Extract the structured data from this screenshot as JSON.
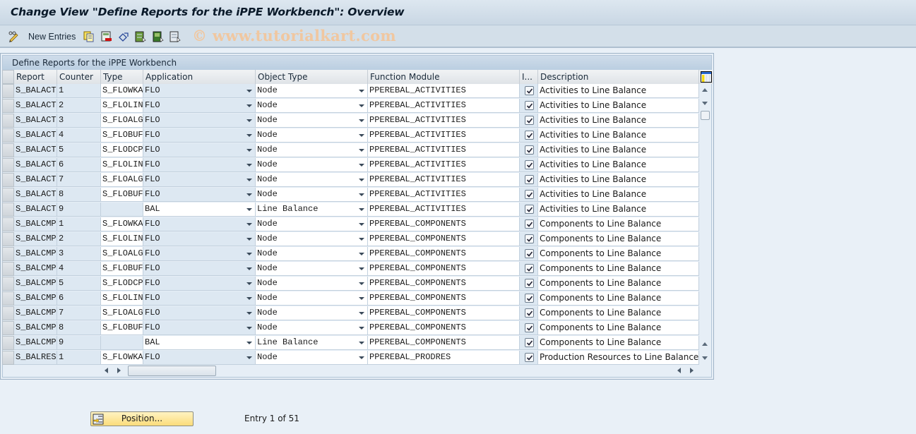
{
  "window": {
    "title": "Change View \"Define Reports for the iPPE Workbench\": Overview"
  },
  "toolbar": {
    "new_entries_label": "New Entries",
    "icons": [
      "change-display-icon",
      "copy-icon",
      "delete-icon",
      "undo-icon",
      "select-all-icon",
      "select-block-icon",
      "deselect-all-icon"
    ],
    "watermark": "www.tutorialkart.com"
  },
  "table": {
    "title": "Define Reports for the iPPE Workbench",
    "columns": [
      "Report",
      "Counter",
      "Type",
      "Application",
      "Object Type",
      "Function Module",
      "I...",
      "Description"
    ],
    "rows": [
      {
        "report": "S_BALACT",
        "counter": "1",
        "type": "S_FLOWKA",
        "application": "FLO",
        "object_type": "Node",
        "function_module": "PPEREBAL_ACTIVITIES",
        "checked": true,
        "description": "Activities to Line Balance"
      },
      {
        "report": "S_BALACT",
        "counter": "2",
        "type": "S_FLOLIN",
        "application": "FLO",
        "object_type": "Node",
        "function_module": "PPEREBAL_ACTIVITIES",
        "checked": true,
        "description": "Activities to Line Balance"
      },
      {
        "report": "S_BALACT",
        "counter": "3",
        "type": "S_FLOALG",
        "application": "FLO",
        "object_type": "Node",
        "function_module": "PPEREBAL_ACTIVITIES",
        "checked": true,
        "description": "Activities to Line Balance"
      },
      {
        "report": "S_BALACT",
        "counter": "4",
        "type": "S_FLOBUF",
        "application": "FLO",
        "object_type": "Node",
        "function_module": "PPEREBAL_ACTIVITIES",
        "checked": true,
        "description": "Activities to Line Balance"
      },
      {
        "report": "S_BALACT",
        "counter": "5",
        "type": "S_FLODCP",
        "application": "FLO",
        "object_type": "Node",
        "function_module": "PPEREBAL_ACTIVITIES",
        "checked": true,
        "description": "Activities to Line Balance"
      },
      {
        "report": "S_BALACT",
        "counter": "6",
        "type": "S_FLOLIN",
        "application": "FLO",
        "object_type": "Node",
        "function_module": "PPEREBAL_ACTIVITIES",
        "checked": true,
        "description": "Activities to Line Balance"
      },
      {
        "report": "S_BALACT",
        "counter": "7",
        "type": "S_FLOALG",
        "application": "FLO",
        "object_type": "Node",
        "function_module": "PPEREBAL_ACTIVITIES",
        "checked": true,
        "description": "Activities to Line Balance"
      },
      {
        "report": "S_BALACT",
        "counter": "8",
        "type": "S_FLOBUF",
        "application": "FLO",
        "object_type": "Node",
        "function_module": "PPEREBAL_ACTIVITIES",
        "checked": true,
        "description": "Activities to Line Balance"
      },
      {
        "report": "S_BALACT",
        "counter": "9",
        "type": "",
        "application": "BAL",
        "object_type": "Line Balance",
        "function_module": "PPEREBAL_ACTIVITIES",
        "checked": true,
        "description": "Activities to Line Balance"
      },
      {
        "report": "S_BALCMP",
        "counter": "1",
        "type": "S_FLOWKA",
        "application": "FLO",
        "object_type": "Node",
        "function_module": "PPEREBAL_COMPONENTS",
        "checked": true,
        "description": "Components to Line Balance"
      },
      {
        "report": "S_BALCMP",
        "counter": "2",
        "type": "S_FLOLIN",
        "application": "FLO",
        "object_type": "Node",
        "function_module": "PPEREBAL_COMPONENTS",
        "checked": true,
        "description": "Components to Line Balance"
      },
      {
        "report": "S_BALCMP",
        "counter": "3",
        "type": "S_FLOALG",
        "application": "FLO",
        "object_type": "Node",
        "function_module": "PPEREBAL_COMPONENTS",
        "checked": true,
        "description": "Components to Line Balance"
      },
      {
        "report": "S_BALCMP",
        "counter": "4",
        "type": "S_FLOBUF",
        "application": "FLO",
        "object_type": "Node",
        "function_module": "PPEREBAL_COMPONENTS",
        "checked": true,
        "description": "Components to Line Balance"
      },
      {
        "report": "S_BALCMP",
        "counter": "5",
        "type": "S_FLODCP",
        "application": "FLO",
        "object_type": "Node",
        "function_module": "PPEREBAL_COMPONENTS",
        "checked": true,
        "description": "Components to Line Balance"
      },
      {
        "report": "S_BALCMP",
        "counter": "6",
        "type": "S_FLOLIN",
        "application": "FLO",
        "object_type": "Node",
        "function_module": "PPEREBAL_COMPONENTS",
        "checked": true,
        "description": "Components to Line Balance"
      },
      {
        "report": "S_BALCMP",
        "counter": "7",
        "type": "S_FLOALG",
        "application": "FLO",
        "object_type": "Node",
        "function_module": "PPEREBAL_COMPONENTS",
        "checked": true,
        "description": "Components to Line Balance"
      },
      {
        "report": "S_BALCMP",
        "counter": "8",
        "type": "S_FLOBUF",
        "application": "FLO",
        "object_type": "Node",
        "function_module": "PPEREBAL_COMPONENTS",
        "checked": true,
        "description": "Components to Line Balance"
      },
      {
        "report": "S_BALCMP",
        "counter": "9",
        "type": "",
        "application": "BAL",
        "object_type": "Line Balance",
        "function_module": "PPEREBAL_COMPONENTS",
        "checked": true,
        "description": "Components to Line Balance"
      },
      {
        "report": "S_BALRES",
        "counter": "1",
        "type": "S_FLOWKA",
        "application": "FLO",
        "object_type": "Node",
        "function_module": "PPEREBAL_PRODRES",
        "checked": true,
        "description": "Production Resources to Line Balance"
      }
    ]
  },
  "footer": {
    "position_button_label": "Position...",
    "entry_info": "Entry 1 of 51"
  },
  "colors": {
    "readonly_cell": "#dde8f2",
    "editable_cell": "#ffffff",
    "position_button": "#fbdc7a"
  }
}
